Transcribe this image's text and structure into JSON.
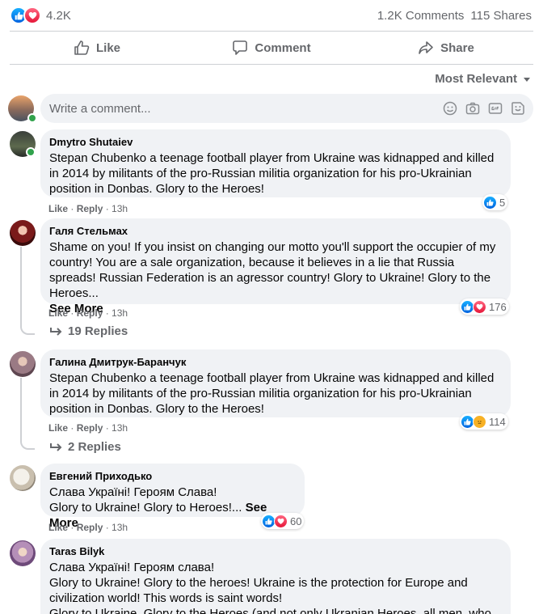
{
  "summary": {
    "reaction_count": "4.2K",
    "comments": "1.2K Comments",
    "shares": "115 Shares"
  },
  "actions": {
    "like": "Like",
    "comment": "Comment",
    "share": "Share"
  },
  "sort": {
    "label": "Most Relevant"
  },
  "composer": {
    "placeholder": "Write a comment..."
  },
  "colors": {
    "like_blue": "#1877f2",
    "love_red": "#f33e58",
    "online_green": "#31a24c"
  },
  "comments": [
    {
      "name": "Dmytro Shutaiev",
      "text": "Stepan Chubenko a teenage football player from Ukraine was kidnapped and killed in 2014 by militants of the pro-Russian militia organization for his pro-Ukrainian position in Donbas. Glory to the Heroes!",
      "like": "Like",
      "reply": "Reply",
      "time": "13h",
      "reactions": "5"
    },
    {
      "name": "Галя Стельмах",
      "text": "Shame on you! If you insist on changing our motto you'll support the occupier of my country! You are a sale organization, because it believes in a lie that Russia spreads! Russian Federation is an agressor country! Glory to Ukraine! Glory to the Heroes...",
      "see_more": "See More",
      "like": "Like",
      "reply": "Reply",
      "time": "13h",
      "reactions": "176",
      "replies": "19 Replies"
    },
    {
      "name": "Галина Дмитрук-Баранчук",
      "text": "Stepan Chubenko a teenage football player from Ukraine was kidnapped and killed in 2014 by militants of the pro-Russian militia organization for his pro-Ukrainian position in Donbas. Glory to the Heroes!",
      "like": "Like",
      "reply": "Reply",
      "time": "13h",
      "reactions": "114",
      "replies": "2 Replies"
    },
    {
      "name": "Евгений Приходько",
      "text1": "Слава Україні! Героям Слава!",
      "text2": "Glory to Ukraine! Glory to Heroes!...",
      "see_more": "See More",
      "like": "Like",
      "reply": "Reply",
      "time": "13h",
      "reactions": "60"
    },
    {
      "name": "Taras Bilyk",
      "text": "Слава Україні! Героям слава!\nGlory to Ukraine! Glory to the heroes! Ukraine is the protection for Europe and civilization world! This words is saint words!\nGlory to Ukraine. Glory to the Heroes (and not only Ukranian Heroes, all men, who"
    }
  ]
}
